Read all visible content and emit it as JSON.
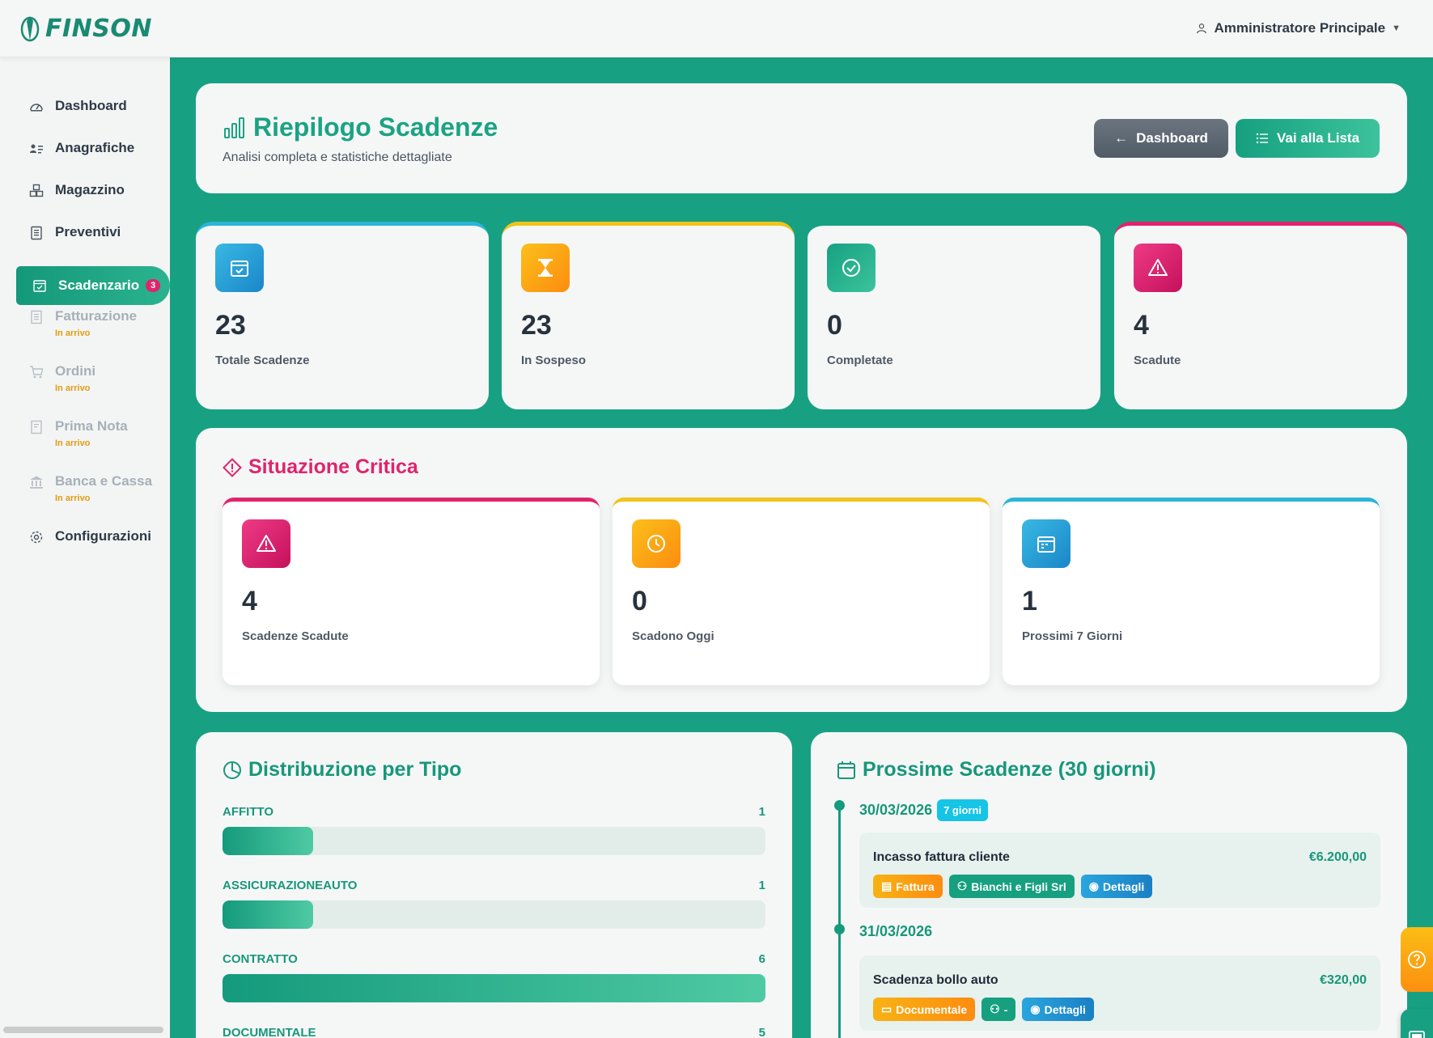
{
  "app": {
    "logo_text": "FINSON",
    "user_name": "Amministratore Principale"
  },
  "sidebar": {
    "items": [
      {
        "label": "Dashboard",
        "icon": "gauge-icon"
      },
      {
        "label": "Anagrafiche",
        "icon": "people-list-icon"
      },
      {
        "label": "Magazzino",
        "icon": "boxes-icon"
      },
      {
        "label": "Preventivi",
        "icon": "document-icon"
      },
      {
        "label": "Scadenzario",
        "icon": "calendar-check-icon",
        "badge": "3"
      },
      {
        "label": "Fatturazione",
        "icon": "invoice-icon",
        "note": "In arrivo"
      },
      {
        "label": "Ordini",
        "icon": "cart-icon",
        "note": "In arrivo"
      },
      {
        "label": "Prima Nota",
        "icon": "journal-icon",
        "note": "In arrivo"
      },
      {
        "label": "Banca e Cassa",
        "icon": "bank-icon",
        "note": "In arrivo"
      },
      {
        "label": "Configurazioni",
        "icon": "gear-icon"
      }
    ]
  },
  "header": {
    "title": "Riepilogo Scadenze",
    "subtitle": "Analisi completa e statistiche dettagliate",
    "btn_dashboard": "Dashboard",
    "btn_list": "Vai alla Lista"
  },
  "stats": [
    {
      "value": "23",
      "label": "Totale Scadenze",
      "color": "#2bb5d8"
    },
    {
      "value": "23",
      "label": "In Sospeso",
      "color": "#f0c419"
    },
    {
      "value": "0",
      "label": "Completate",
      "color": "#17a182"
    },
    {
      "value": "4",
      "label": "Scadute",
      "color": "#e0246c"
    }
  ],
  "critical": {
    "title": "Situazione Critica",
    "items": [
      {
        "value": "4",
        "label": "Scadenze Scadute",
        "color": "#e0246c"
      },
      {
        "value": "0",
        "label": "Scadono Oggi",
        "color": "#f0c419"
      },
      {
        "value": "1",
        "label": "Prossimi 7 Giorni",
        "color": "#2bb5d8"
      }
    ]
  },
  "distribution": {
    "title": "Distribuzione per Tipo",
    "max": 6,
    "rows": [
      {
        "label": "AFFITTO",
        "value": "1",
        "fraction": 0.1667
      },
      {
        "label": "ASSICURAZIONEAUTO",
        "value": "1",
        "fraction": 0.1667
      },
      {
        "label": "CONTRATTO",
        "value": "6",
        "fraction": 1.0
      },
      {
        "label": "DOCUMENTALE",
        "value": "5",
        "fraction": 0.8333
      }
    ]
  },
  "upcoming": {
    "title": "Prossime Scadenze (30 giorni)",
    "groups": [
      {
        "date": "30/03/2026",
        "badge": "7 giorni",
        "name": "Incasso fattura cliente",
        "amount": "€6.200,00",
        "tags": [
          "Fattura",
          "Bianchi e Figli Srl",
          "Dettagli"
        ]
      },
      {
        "date": "31/03/2026",
        "badge": "",
        "name": "Scadenza bollo auto",
        "amount": "€320,00",
        "tags": [
          "Documentale",
          "-",
          "Dettagli"
        ]
      }
    ]
  }
}
